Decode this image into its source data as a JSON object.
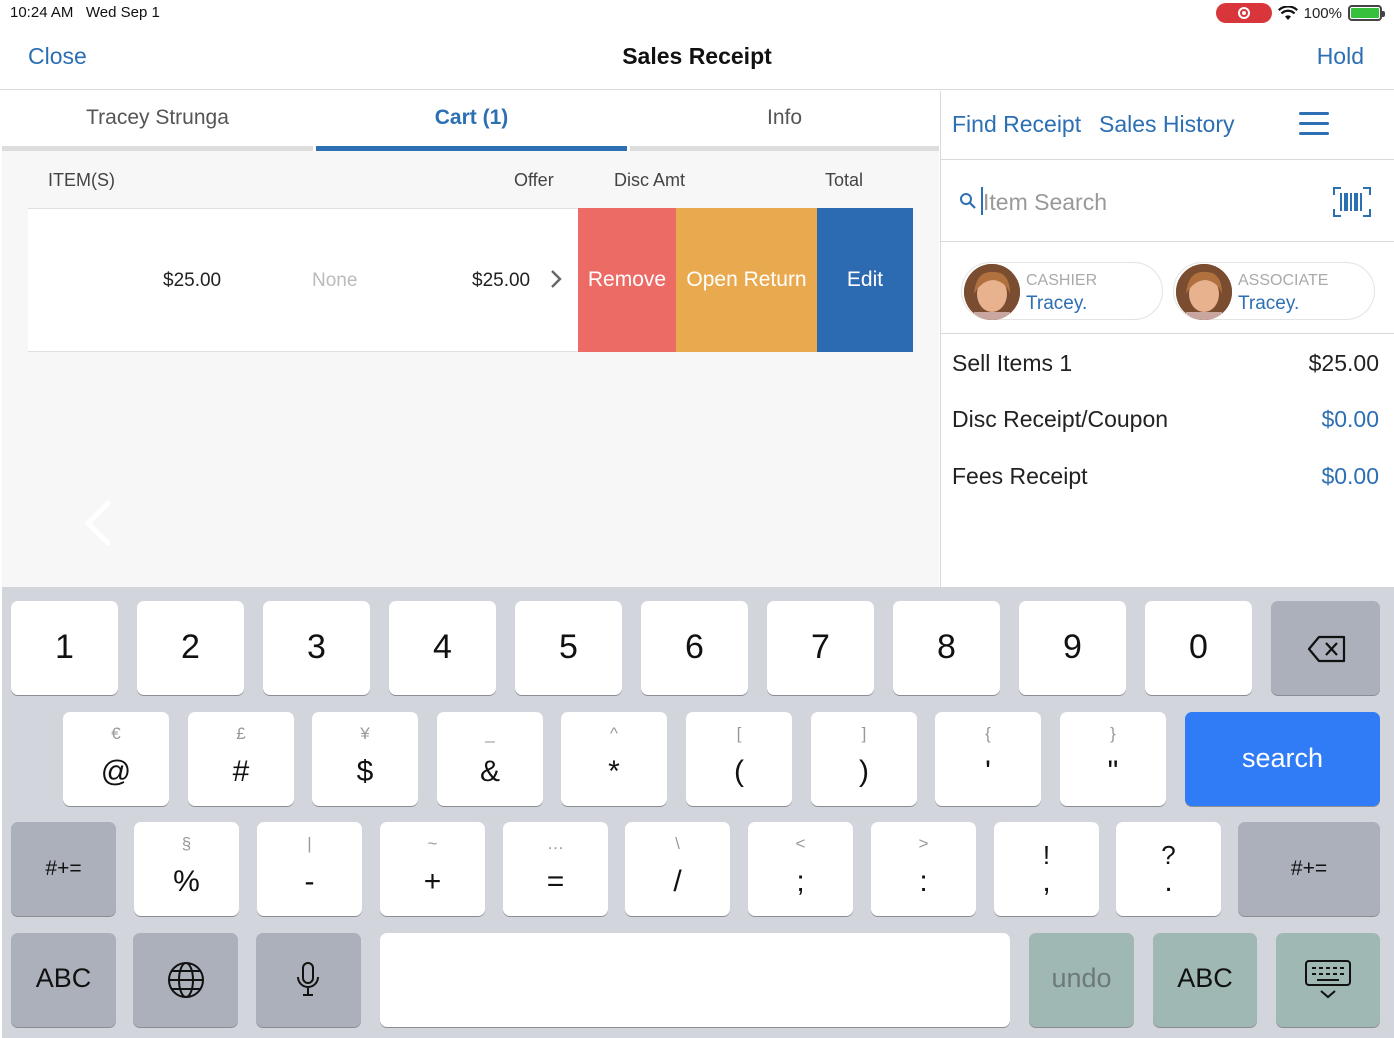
{
  "status_bar": {
    "time": "10:24 AM",
    "date": "Wed Sep 1",
    "battery": "100%",
    "recording_color": "#d8363b"
  },
  "nav": {
    "close_label": "Close",
    "title": "Sales Receipt",
    "hold_label": "Hold"
  },
  "tabs": [
    {
      "label": "Tracey Strunga",
      "active": false
    },
    {
      "label": "Cart (1)",
      "active": true
    },
    {
      "label": "Info",
      "active": false
    }
  ],
  "cart": {
    "columns": {
      "items": "ITEM(S)",
      "offer": "Offer",
      "disc_amt": "Disc Amt",
      "total": "Total"
    },
    "row": {
      "offer": "$25.00",
      "disc_amt": "None",
      "total": "$25.00"
    },
    "actions": {
      "remove": "Remove",
      "open_return": "Open Return",
      "edit": "Edit"
    }
  },
  "right_panel": {
    "find_receipt": "Find Receipt",
    "sales_history": "Sales History",
    "search_placeholder": "Item Search",
    "cashier": {
      "role": "CASHIER",
      "name": "Tracey."
    },
    "associate": {
      "role": "ASSOCIATE",
      "name": "Tracey."
    },
    "summary": [
      {
        "label": "Sell Items 1",
        "value": "$25.00"
      },
      {
        "label": "Disc Receipt/Coupon",
        "value": "$0.00"
      },
      {
        "label": "Fees Receipt",
        "value": "$0.00"
      }
    ]
  },
  "keyboard": {
    "row1": [
      "1",
      "2",
      "3",
      "4",
      "5",
      "6",
      "7",
      "8",
      "9",
      "0"
    ],
    "row2": [
      {
        "alt": "€",
        "main": "@"
      },
      {
        "alt": "£",
        "main": "#"
      },
      {
        "alt": "¥",
        "main": "$"
      },
      {
        "alt": "_",
        "main": "&"
      },
      {
        "alt": "^",
        "main": "*"
      },
      {
        "alt": "[",
        "main": "("
      },
      {
        "alt": "]",
        "main": ")"
      },
      {
        "alt": "{",
        "main": "'"
      },
      {
        "alt": "}",
        "main": "\""
      }
    ],
    "row3": [
      {
        "alt": "§",
        "main": "%"
      },
      {
        "alt": "|",
        "main": "-"
      },
      {
        "alt": "~",
        "main": "+"
      },
      {
        "alt": "…",
        "main": "="
      },
      {
        "alt": "\\",
        "main": "/"
      },
      {
        "alt": "<",
        "main": ";"
      },
      {
        "alt": ">",
        "main": ":"
      },
      {
        "alt": "!",
        "main": ","
      },
      {
        "alt": "?",
        "main": "."
      }
    ],
    "search_label": "search",
    "symbols_label": "#+=",
    "abc_label": "ABC",
    "undo_label": "undo"
  },
  "colors": {
    "accent": "#2c6fb3",
    "remove": "#ed6b65",
    "open_return": "#e9aa4f",
    "edit": "#2c6bb1",
    "search_key": "#2f7cf6"
  }
}
